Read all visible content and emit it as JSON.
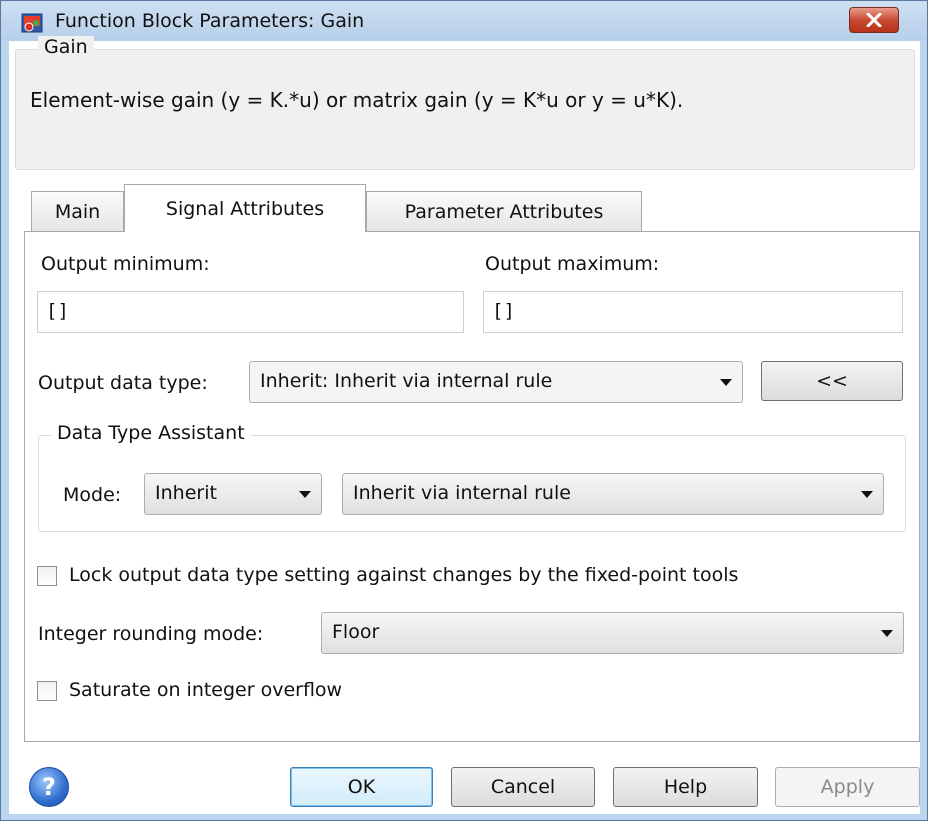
{
  "window": {
    "title": "Function Block Parameters: Gain"
  },
  "gain_group": {
    "legend": "Gain",
    "description": "Element-wise gain (y = K.*u) or matrix gain (y = K*u or y = u*K)."
  },
  "tabs": [
    {
      "label": "Main",
      "selected": false
    },
    {
      "label": "Signal Attributes",
      "selected": true
    },
    {
      "label": "Parameter Attributes",
      "selected": false
    }
  ],
  "signal": {
    "output_min_label": "Output minimum:",
    "output_min_value": "[]",
    "output_max_label": "Output maximum:",
    "output_max_value": "[]",
    "data_type_label": "Output data type:",
    "data_type_value": "Inherit: Inherit via internal rule",
    "toggle_assistant_label": "<<",
    "assistant": {
      "legend": "Data Type Assistant",
      "mode_label": "Mode:",
      "mode_value": "Inherit",
      "rule_value": "Inherit via internal rule"
    },
    "lock_label": "Lock output data type setting against changes by the fixed-point tools",
    "lock_checked": false,
    "rounding_label": "Integer rounding mode:",
    "rounding_value": "Floor",
    "saturate_label": "Saturate on integer overflow",
    "saturate_checked": false
  },
  "buttons": {
    "ok": "OK",
    "cancel": "Cancel",
    "help": "Help",
    "apply": "Apply"
  },
  "icons": {
    "help": "help-icon",
    "close": "close-icon",
    "app": "simulink-icon"
  }
}
